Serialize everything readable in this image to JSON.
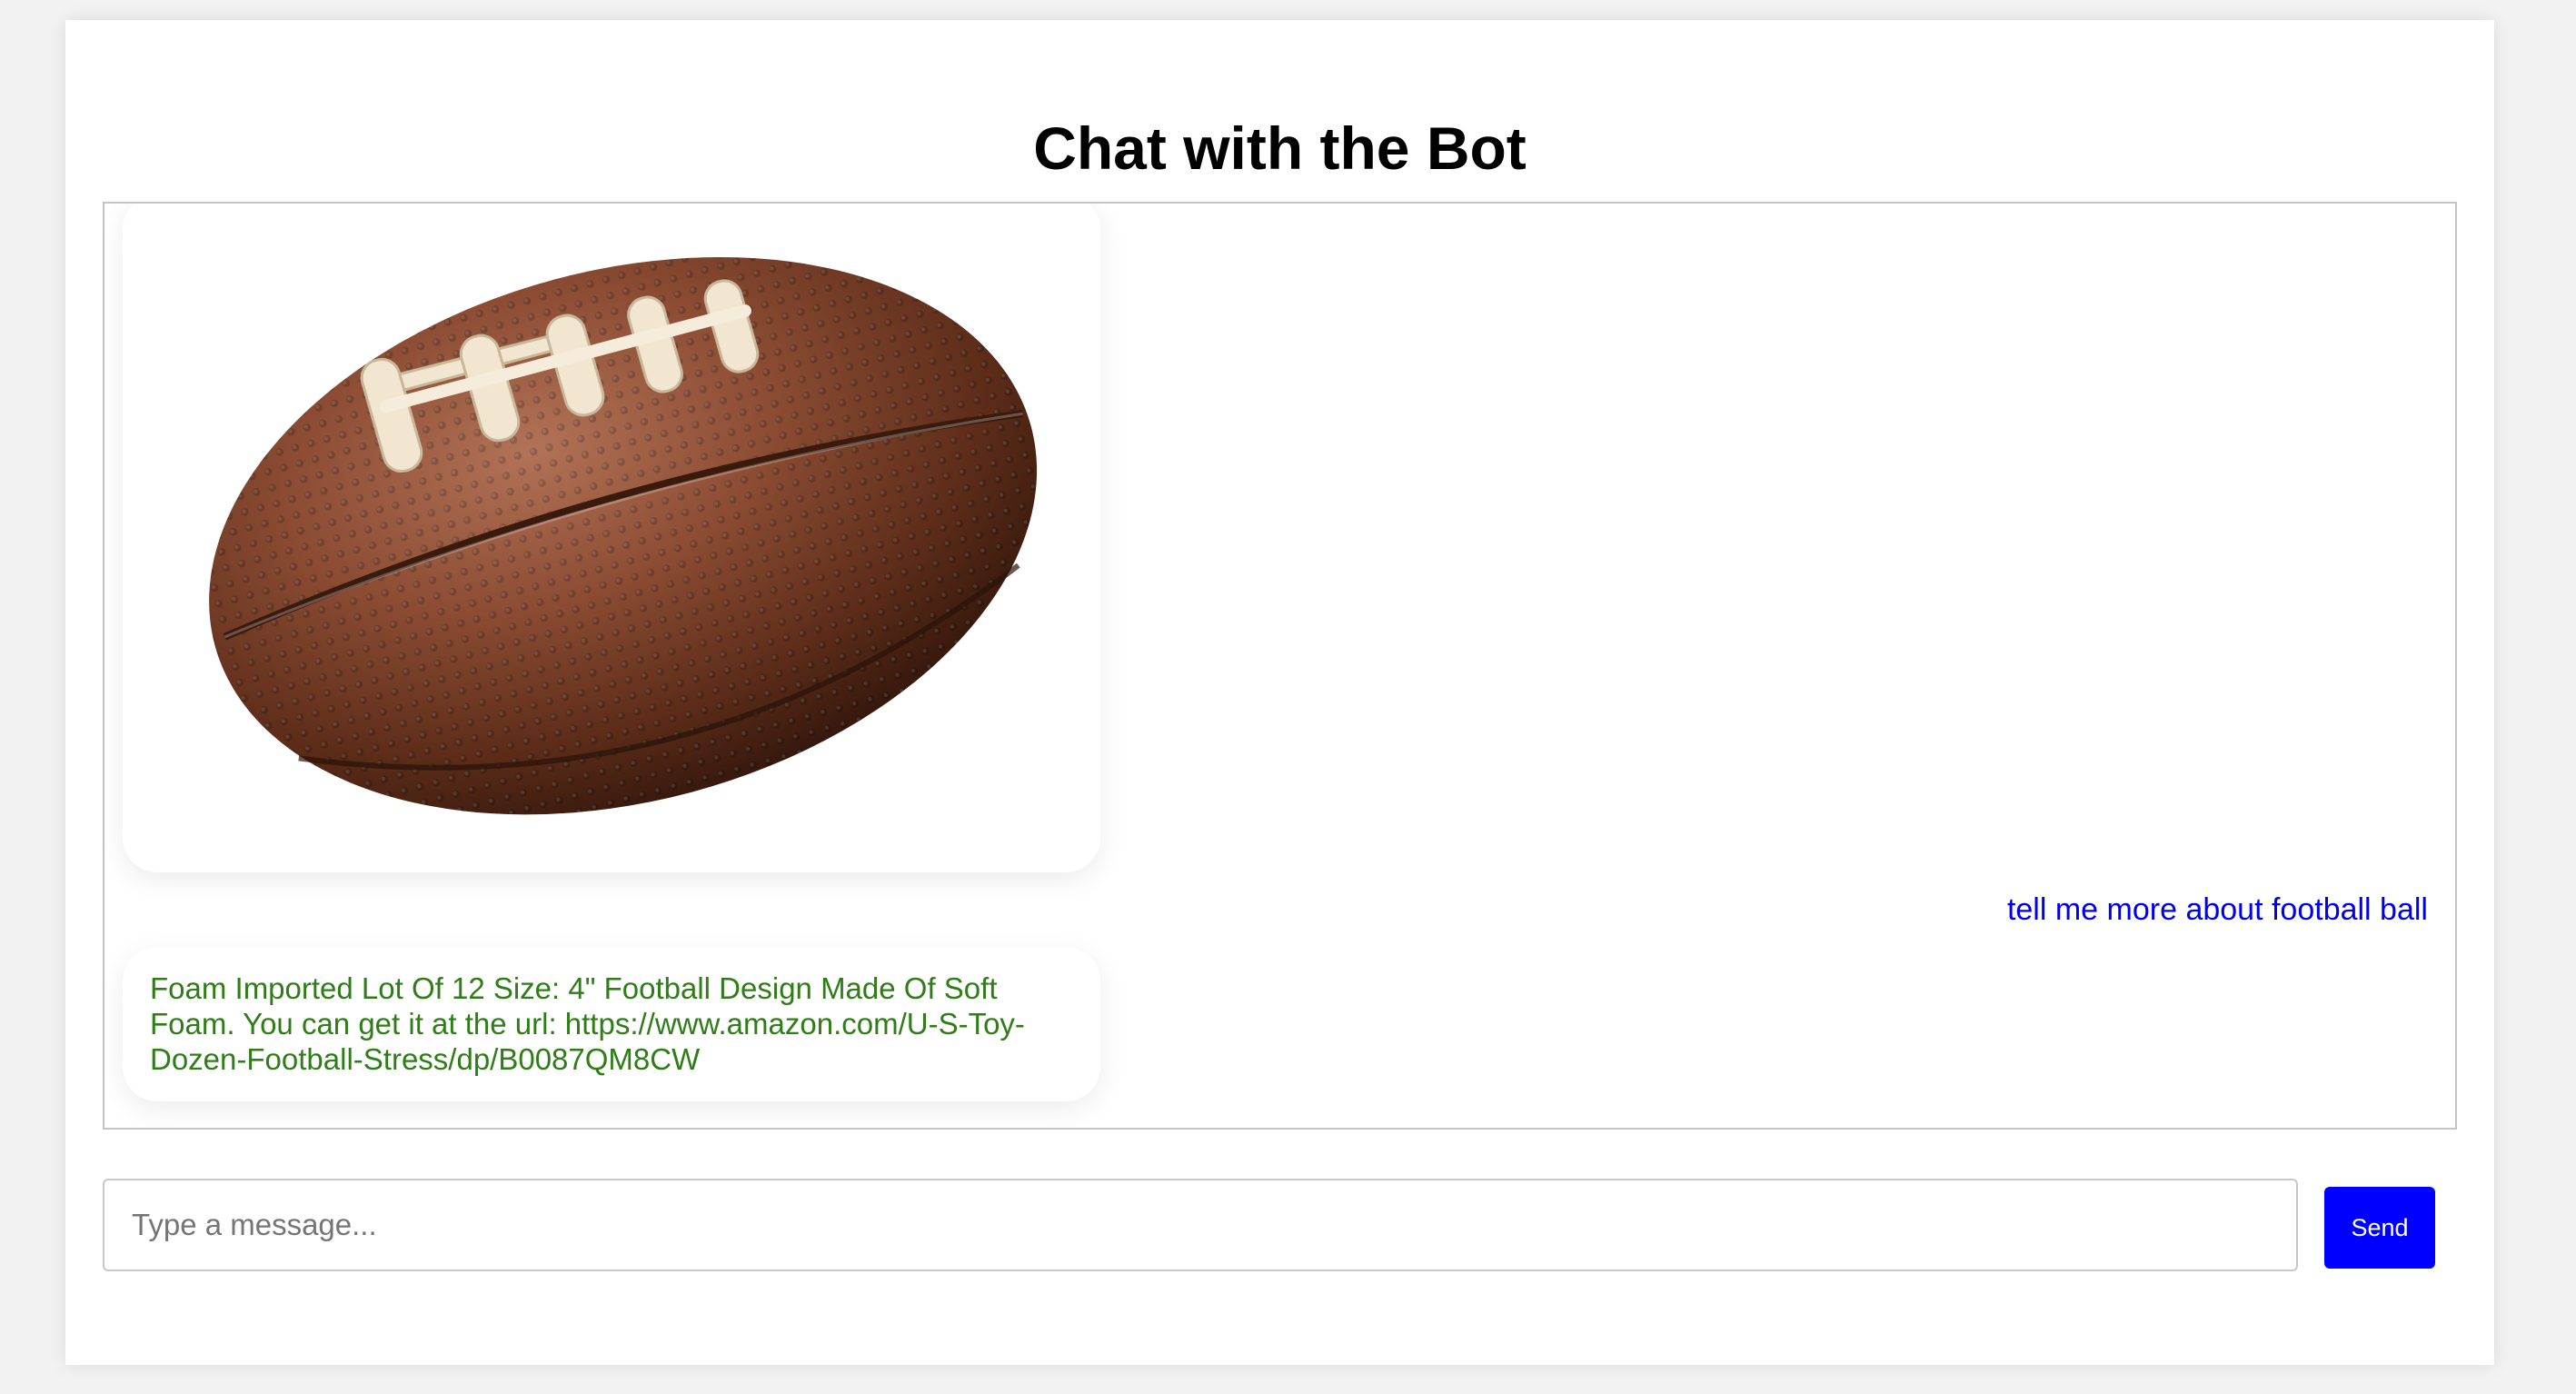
{
  "header": {
    "title": "Chat with the Bot"
  },
  "chat": {
    "messages": [
      {
        "sender": "bot",
        "type": "image",
        "image_subject": "football"
      },
      {
        "sender": "user",
        "text": "tell me more about football ball"
      },
      {
        "sender": "bot",
        "type": "text",
        "text": "Foam Imported Lot Of 12 Size: 4\" Football Design Made Of Soft Foam. You can get it at the url: https://www.amazon.com/U-S-Toy-Dozen-Football-Stress/dp/B0087QM8CW"
      }
    ]
  },
  "composer": {
    "placeholder": "Type a message...",
    "value": "",
    "send_label": "Send"
  },
  "colors": {
    "user_text": "#0000ee",
    "bot_text": "#2e7d17",
    "send_button": "#0000ff",
    "page_background": "#f2f2f2"
  }
}
